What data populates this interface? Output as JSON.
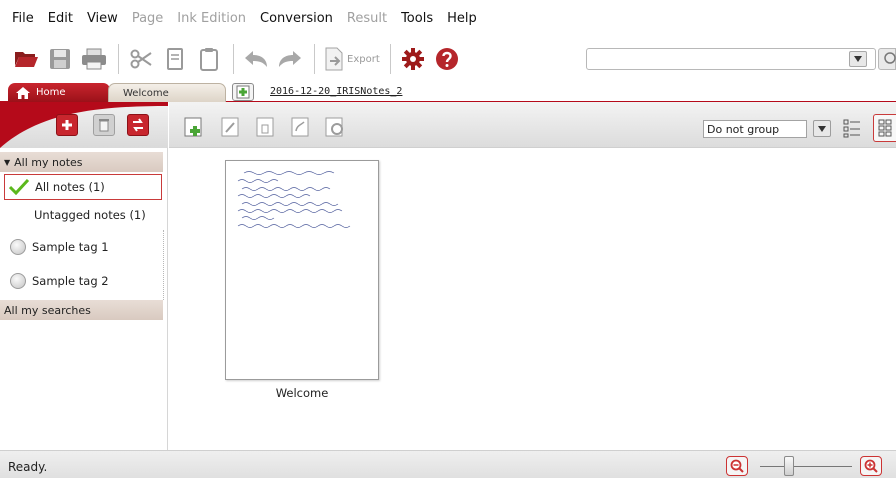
{
  "menu": [
    {
      "label": "File",
      "enabled": true
    },
    {
      "label": "Edit",
      "enabled": true
    },
    {
      "label": "View",
      "enabled": true
    },
    {
      "label": "Page",
      "enabled": false
    },
    {
      "label": "Ink Edition",
      "enabled": false
    },
    {
      "label": "Conversion",
      "enabled": true
    },
    {
      "label": "Result",
      "enabled": false
    },
    {
      "label": "Tools",
      "enabled": true
    },
    {
      "label": "Help",
      "enabled": true
    }
  ],
  "toolbar": {
    "export_label": "Export",
    "search_value": "",
    "icons": [
      "open-folder-icon",
      "save-icon",
      "print-icon",
      "cut-icon",
      "copy-icon",
      "paste-icon",
      "undo-icon",
      "redo-icon",
      "export-icon",
      "settings-gear-icon",
      "help-icon"
    ]
  },
  "tabs": {
    "home": "Home",
    "welcome": "Welcome",
    "document": "2016-12-20_IRISNotes_2"
  },
  "sidebar": {
    "notes_section": "All my notes",
    "items": [
      {
        "label": "All notes (1)",
        "selected": true
      },
      {
        "label": "Untagged notes (1)",
        "selected": false
      },
      {
        "label": "Sample tag 1",
        "selected": false
      },
      {
        "label": "Sample tag 2",
        "selected": false
      }
    ],
    "searches_section": "All my searches"
  },
  "main": {
    "group_by": "Do not group",
    "notes": [
      {
        "title": "Welcome"
      }
    ]
  },
  "status": {
    "text": "Ready."
  },
  "colors": {
    "brand_red": "#b50a1a",
    "add_green": "#4aa536",
    "check_green": "#5bb81c"
  }
}
